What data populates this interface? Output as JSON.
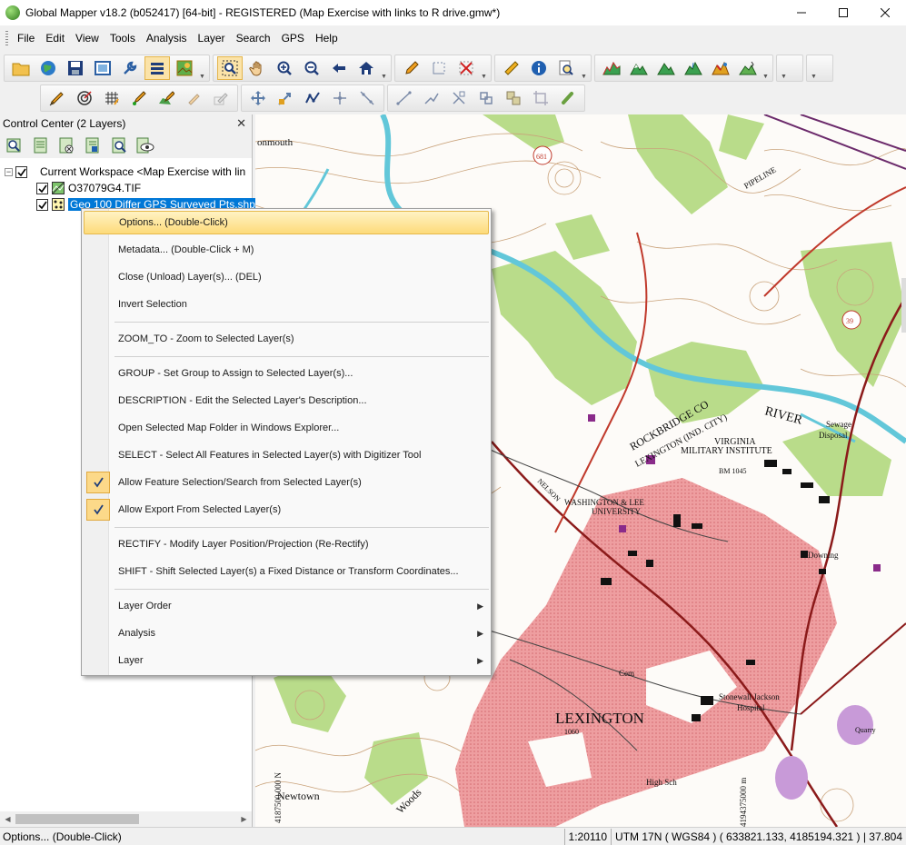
{
  "window": {
    "title": "Global Mapper v18.2 (b052417) [64-bit] - REGISTERED (Map Exercise with links to R drive.gmw*)"
  },
  "menubar": [
    "File",
    "Edit",
    "View",
    "Tools",
    "Analysis",
    "Layer",
    "Search",
    "GPS",
    "Help"
  ],
  "control_center": {
    "title": "Control Center (2 Layers)",
    "workspace_label": "Current Workspace <Map Exercise with lin",
    "layers": [
      {
        "name": "O37079G4.TIF",
        "checked": true,
        "icon": "raster-layer-icon"
      },
      {
        "name": "Geo 100 Differ GPS Surveyed Pts.shp [",
        "checked": true,
        "icon": "point-layer-icon",
        "selected": true
      }
    ]
  },
  "context_menu": {
    "items": [
      {
        "label": "Options... (Double-Click)",
        "highlight": true
      },
      {
        "label": "Metadata... (Double-Click + M)"
      },
      {
        "label": "Close (Unload) Layer(s)... (DEL)"
      },
      {
        "label": "Invert Selection"
      },
      {
        "label": "ZOOM_TO - Zoom to Selected Layer(s)"
      },
      {
        "label": "GROUP - Set Group to Assign to Selected Layer(s)..."
      },
      {
        "label": "DESCRIPTION - Edit the Selected Layer's Description..."
      },
      {
        "label": "Open Selected Map Folder in Windows Explorer..."
      },
      {
        "label": "SELECT - Select All Features in Selected Layer(s) with Digitizer Tool"
      },
      {
        "label": "Allow Feature Selection/Search from Selected Layer(s)",
        "checked": true
      },
      {
        "label": "Allow Export From Selected Layer(s)",
        "checked": true
      },
      {
        "label": "RECTIFY - Modify Layer Position/Projection (Re-Rectify)"
      },
      {
        "label": "SHIFT - Shift Selected Layer(s) a Fixed Distance or Transform Coordinates..."
      },
      {
        "label": "Layer Order",
        "submenu": true
      },
      {
        "label": "Analysis",
        "submenu": true
      },
      {
        "label": "Layer",
        "submenu": true
      }
    ]
  },
  "map": {
    "labels": {
      "monmouth": "onmouth",
      "river": "RIVER",
      "rockbridge": "ROCKBRIDGE CO",
      "lexington_city": "LEXINGTON (IND. CITY)",
      "vmi1": "VIRGINIA",
      "vmi2": "MILITARY INSTITUTE",
      "wl": "WASHINGTON & LEE",
      "wl2": "UNIVERSITY",
      "lexington": "LEXINGTON",
      "newtown": "Newtown",
      "pipeline": "PIPELINE",
      "sewage": "Sewage",
      "disposal": "Disposal",
      "stonewall": "Stonewall Jackson",
      "hospital": "Hospital",
      "downing": "Downing",
      "cem": "Cem",
      "high_sch": "High Sch",
      "bm1045": "BM 1045",
      "bm1060": "1060",
      "woods": "Woods",
      "nelson": "NELSON",
      "quarry": "Quarry",
      "route681": "681",
      "route39": "39",
      "northing": "4187500 000 N",
      "northing2": "4194375000 m"
    }
  },
  "status": {
    "hint": "Options... (Double-Click)",
    "scale": "1:20110",
    "projection": "UTM 17N ( WGS84 ) ( 633821.133, 4185194.321 ) | 37.804"
  },
  "colors": {
    "highlight": "#fddb7a",
    "selection": "#0078d7",
    "forest": "#b9dc8a",
    "urban": "#e8888c",
    "water": "#62c7d9",
    "contour": "#c9a27a",
    "road": "#c0392b"
  }
}
